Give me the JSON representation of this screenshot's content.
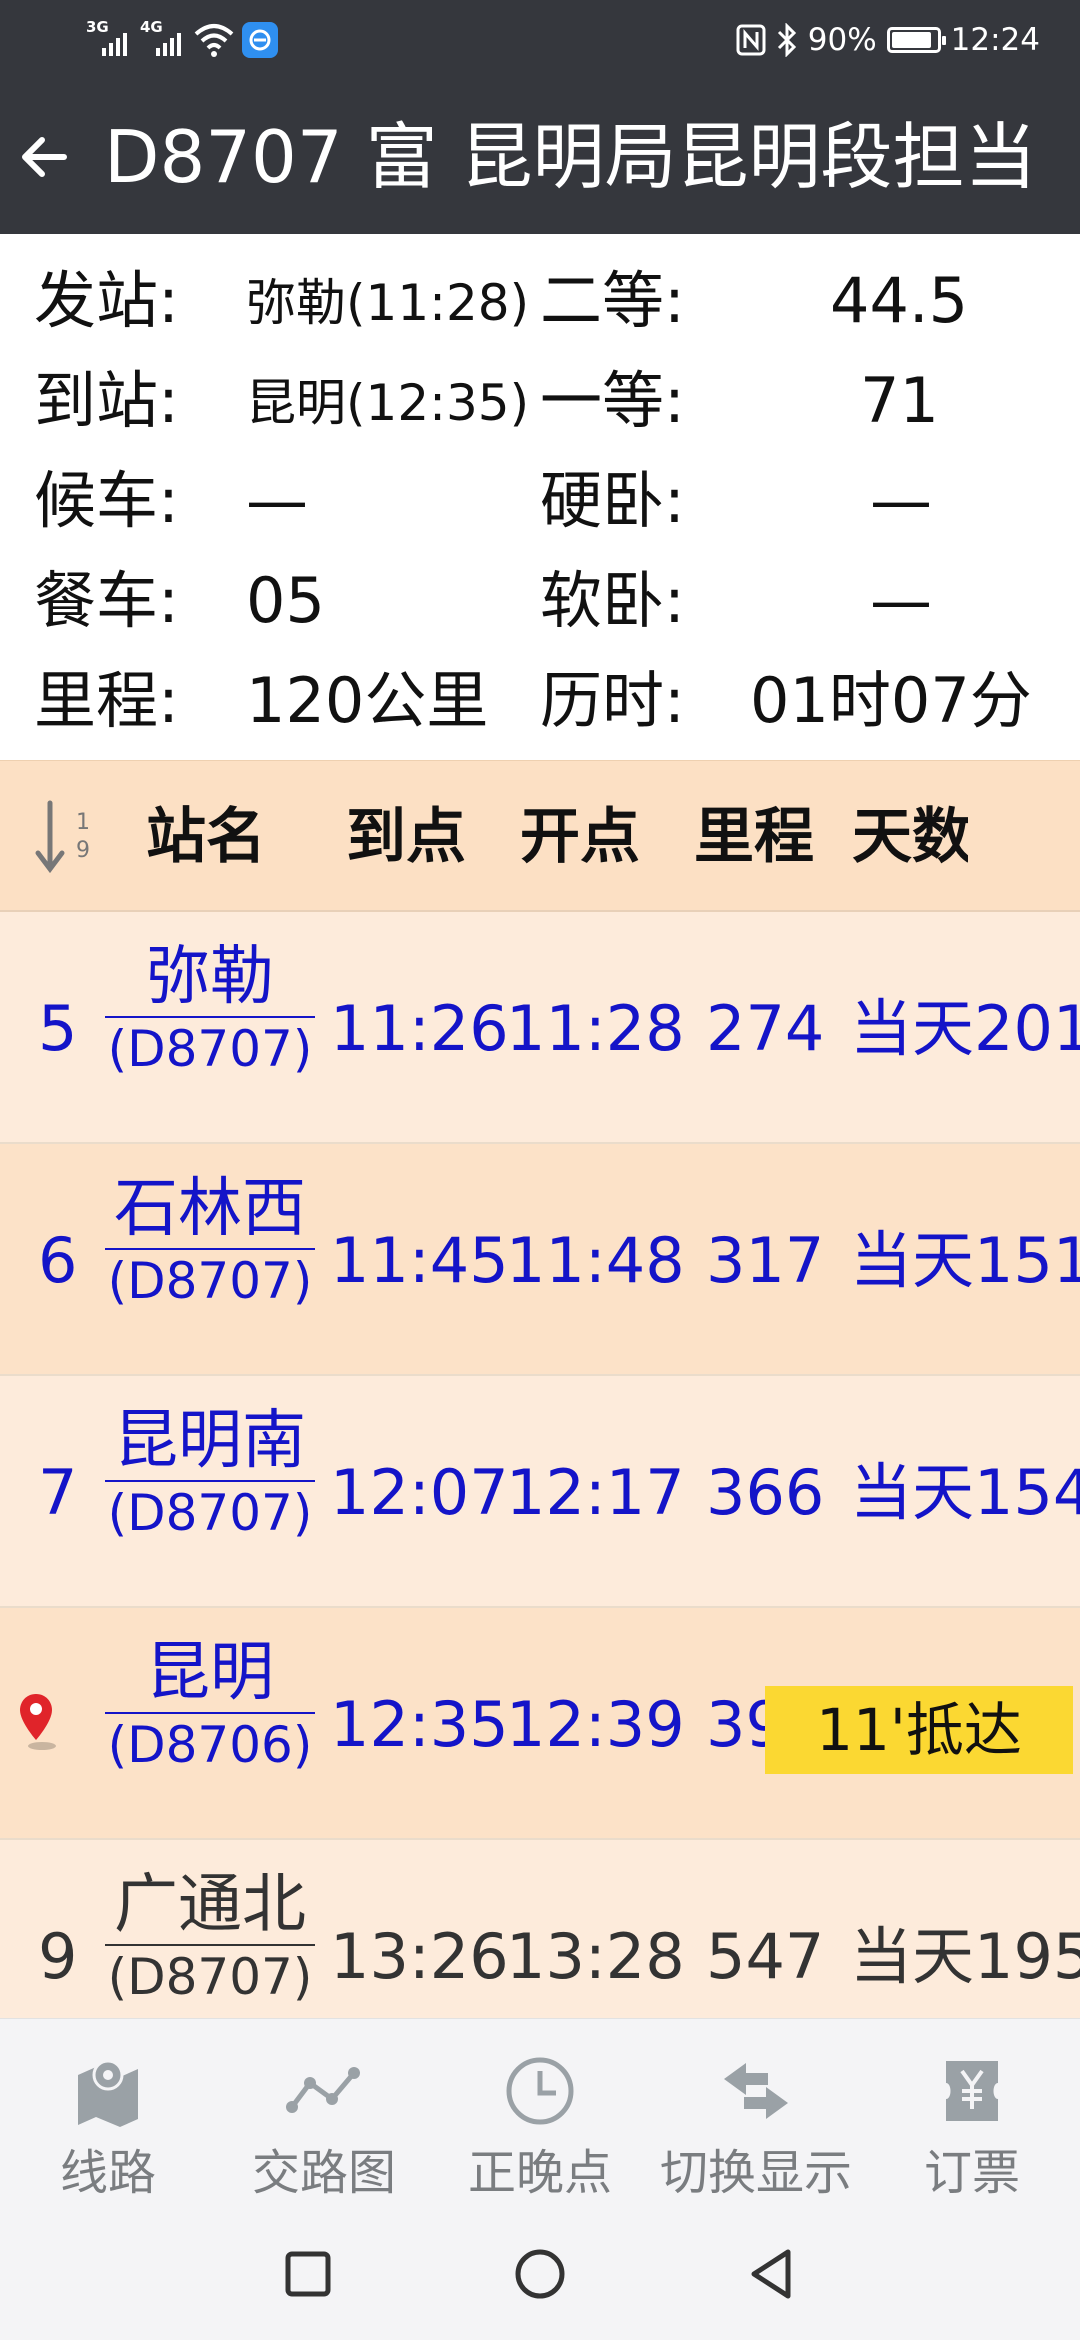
{
  "status_bar": {
    "sim1_label": "3G",
    "sim2_label": "4G",
    "battery": "90%",
    "battery_level": 0.9,
    "time": "12:24"
  },
  "header": {
    "title": "D8707 富 昆明局昆明段担当"
  },
  "info": {
    "from_label": "发站:",
    "from_value": "弥勒(11:28)",
    "to_label": "到站:",
    "to_value": "昆明(12:35)",
    "wait_label": "候车:",
    "wait_value": "—",
    "dining_label": "餐车:",
    "dining_value": "05",
    "distance_label": "里程:",
    "distance_value": "120公里",
    "second_class_label": "二等:",
    "second_class_value": "44.5",
    "first_class_label": "一等:",
    "first_class_value": "71",
    "hard_sleeper_label": "硬卧:",
    "hard_sleeper_value": "—",
    "soft_sleeper_label": "软卧:",
    "soft_sleeper_value": "—",
    "duration_label": "历时:",
    "duration_value": "01时07分"
  },
  "table": {
    "headers": {
      "station": "站名",
      "arrive": "到点",
      "depart": "开点",
      "distance": "里程",
      "days": "天数"
    },
    "rows": [
      {
        "num": "5",
        "station": "弥勒",
        "train": "(D8707)",
        "arrive": "11:26",
        "depart": "11:28",
        "distance": "274",
        "day": "当天201"
      },
      {
        "num": "6",
        "station": "石林西",
        "train": "(D8707)",
        "arrive": "11:45",
        "depart": "11:48",
        "distance": "317",
        "day": "当天151"
      },
      {
        "num": "7",
        "station": "昆明南",
        "train": "(D8707)",
        "arrive": "12:07",
        "depart": "12:17",
        "distance": "366",
        "day": "当天154"
      },
      {
        "num": "",
        "station": "昆明",
        "train": "(D8706)",
        "arrive": "12:35",
        "depart": "12:39",
        "distance": "39",
        "day": "",
        "badge": "11'抵达"
      },
      {
        "num": "9",
        "station": "广通北",
        "train": "(D8707)",
        "arrive": "13:26",
        "depart": "13:28",
        "distance": "547",
        "day": "当天195"
      }
    ]
  },
  "bottom_nav": {
    "items": [
      {
        "label": "线路",
        "icon": "map-icon"
      },
      {
        "label": "交路图",
        "icon": "route-graph-icon"
      },
      {
        "label": "正晚点",
        "icon": "clock-icon"
      },
      {
        "label": "切换显示",
        "icon": "swap-icon"
      },
      {
        "label": "订票",
        "icon": "ticket-icon"
      }
    ]
  },
  "colors": {
    "header_bg": "#35373d",
    "row_light": "#fdebdb",
    "row_dark": "#fce2c8",
    "blue_text": "#1414c8",
    "badge_yellow": "#fbd832",
    "nav_gray": "#7a7d80"
  }
}
